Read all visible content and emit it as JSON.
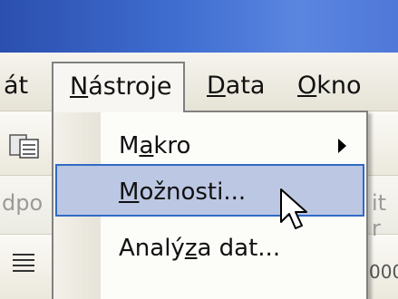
{
  "menubar": {
    "items": [
      {
        "label_pre": "",
        "label_u": "",
        "label_post": "át"
      },
      {
        "label_pre": "",
        "label_u": "N",
        "label_post": "ástroje"
      },
      {
        "label_pre": "",
        "label_u": "D",
        "label_post": "ata"
      },
      {
        "label_pre": "",
        "label_u": "O",
        "label_post": "kno"
      }
    ]
  },
  "dropdown": {
    "items": [
      {
        "label_pre": "M",
        "label_u": "a",
        "label_post": "kro",
        "has_submenu": true
      },
      {
        "label_pre": "",
        "label_u": "M",
        "label_post": "ožnosti...",
        "highlighted": true
      },
      {
        "label_pre": "Analý",
        "label_u": "z",
        "label_post": "a dat..."
      }
    ],
    "more_glyph": "⌄⌄"
  },
  "toolbar": {
    "ghost_left_1": "dpo",
    "ghost_right_1": "it r",
    "ghost_right_2": "000"
  },
  "colors": {
    "titlebar": "#3f6ed1",
    "highlight_fill": "#bcc7e3",
    "highlight_border": "#316ac5"
  }
}
